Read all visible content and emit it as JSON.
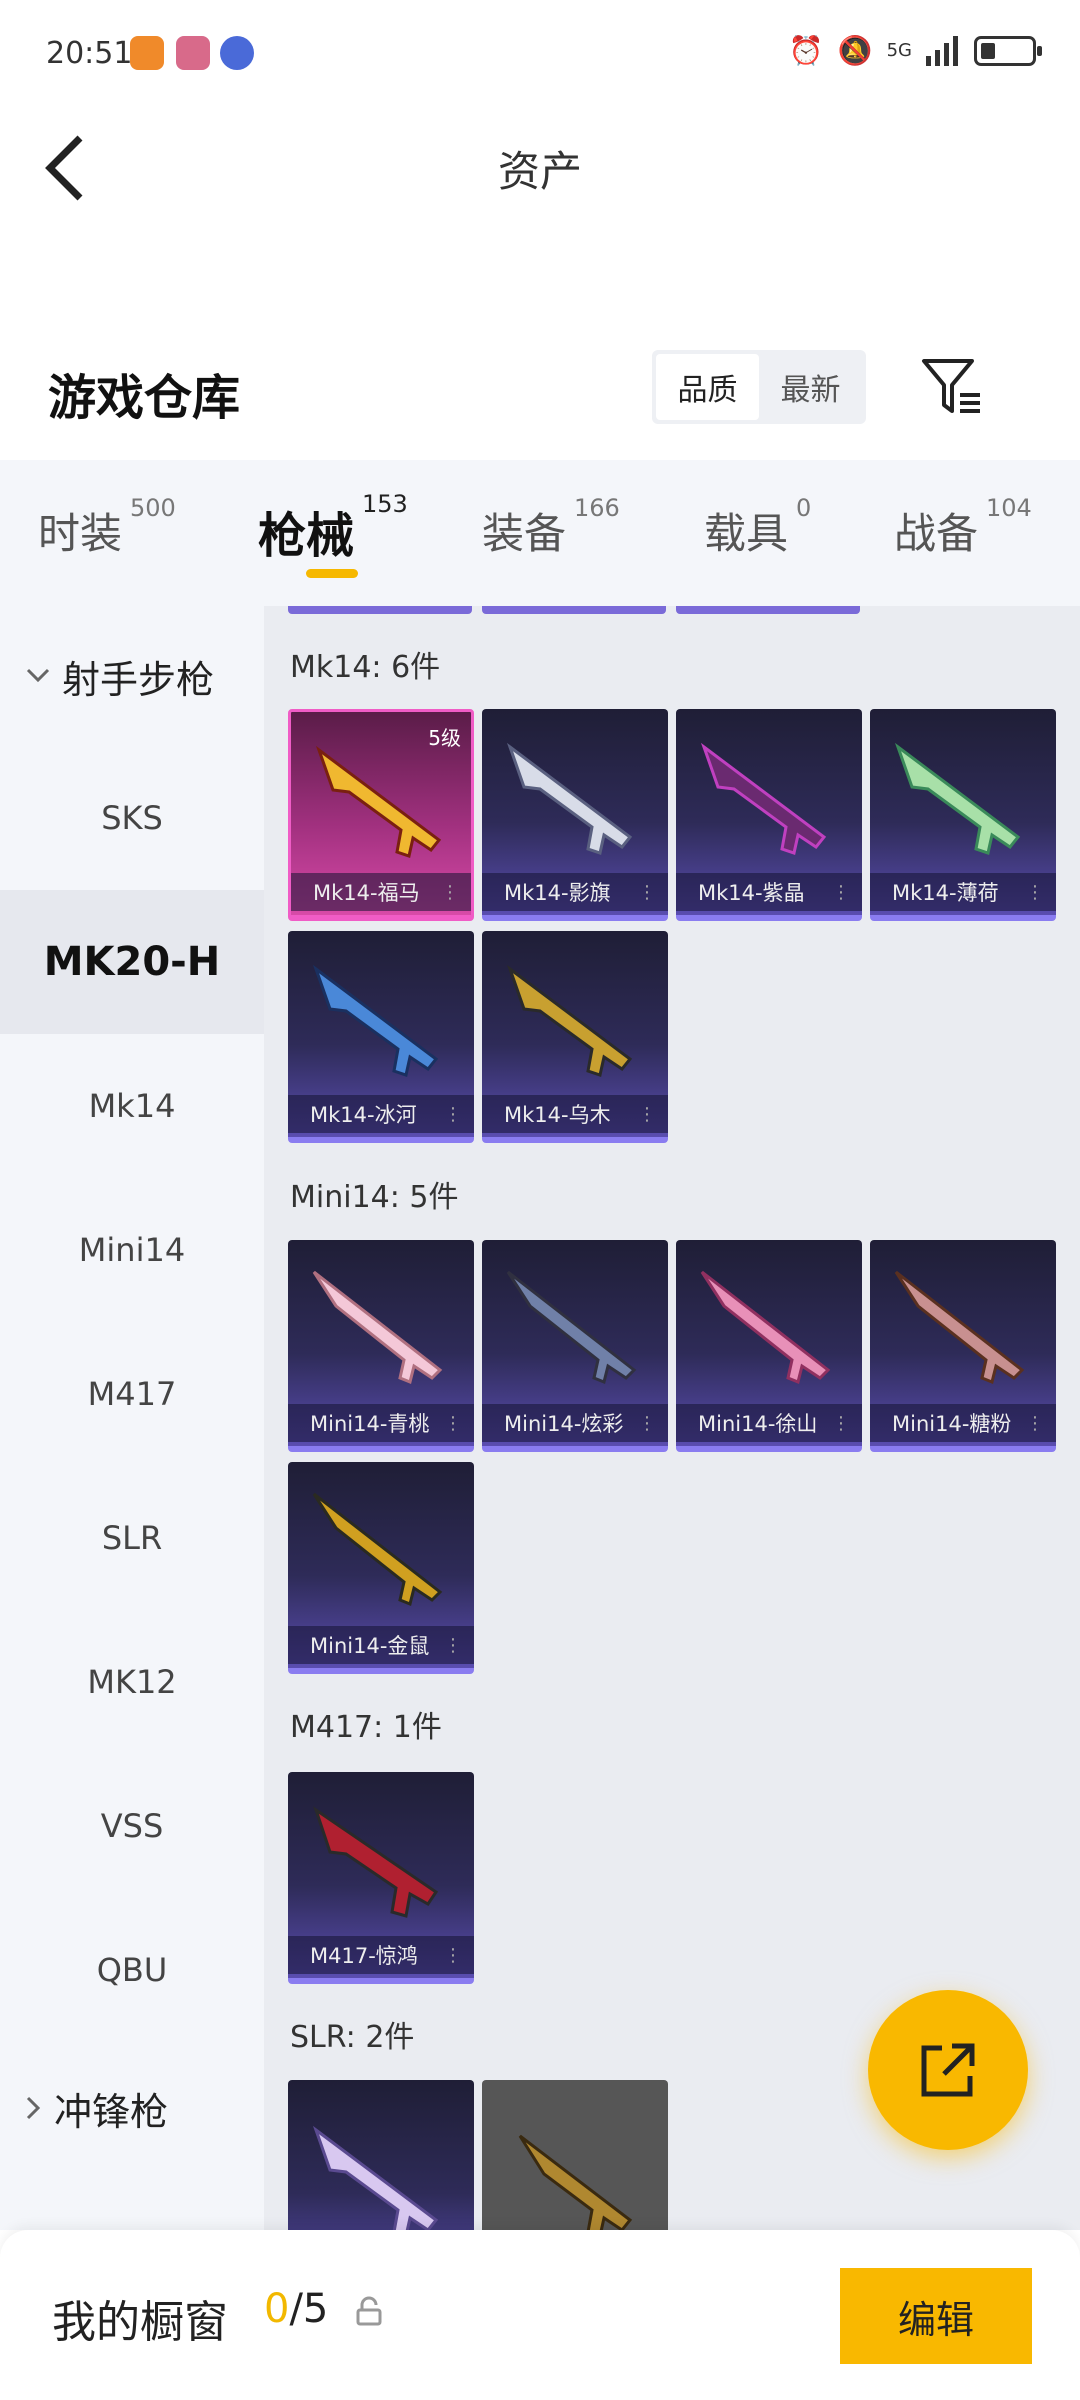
{
  "status_bar": {
    "time": "20:51",
    "network": "5G"
  },
  "header": {
    "title": "资产"
  },
  "section": {
    "title": "游戏仓库",
    "sort_options": [
      "品质",
      "最新"
    ],
    "sort_active": 0
  },
  "tabs": [
    {
      "label": "时装",
      "count": "500"
    },
    {
      "label": "枪械",
      "count": "153",
      "active": true
    },
    {
      "label": "装备",
      "count": "166"
    },
    {
      "label": "载具",
      "count": "0"
    },
    {
      "label": "战备",
      "count": "104"
    }
  ],
  "sidebar": {
    "group_open": "射手步枪",
    "items": [
      "SKS",
      "MK20-H",
      "Mk14",
      "Mini14",
      "M417",
      "SLR",
      "MK12",
      "VSS",
      "QBU"
    ],
    "active_index": 1,
    "group_closed": "冲锋枪"
  },
  "groups": [
    {
      "label": "Mk14: 6件",
      "cards": [
        "Mk14-福马",
        "Mk14-影旗",
        "Mk14-紫晶",
        "Mk14-薄荷",
        "Mk14-冰河",
        "Mk14-乌木"
      ],
      "level_badge": "5级"
    },
    {
      "label": "Mini14: 5件",
      "cards": [
        "Mini14-青桃",
        "Mini14-炫彩",
        "Mini14-徐山",
        "Mini14-糖粉",
        "Mini14-金鼠"
      ]
    },
    {
      "label": "M417: 1件",
      "cards": [
        "M417-惊鸿"
      ]
    },
    {
      "label": "SLR: 2件",
      "cards": [
        "",
        ""
      ]
    }
  ],
  "showcase": {
    "label": "我的橱窗",
    "current": "0",
    "total": "/5",
    "edit_label": "编辑"
  },
  "colors": {
    "accent": "#f9b800",
    "card_purple": "#5a4db0",
    "card_pink": "#d84aa8"
  }
}
